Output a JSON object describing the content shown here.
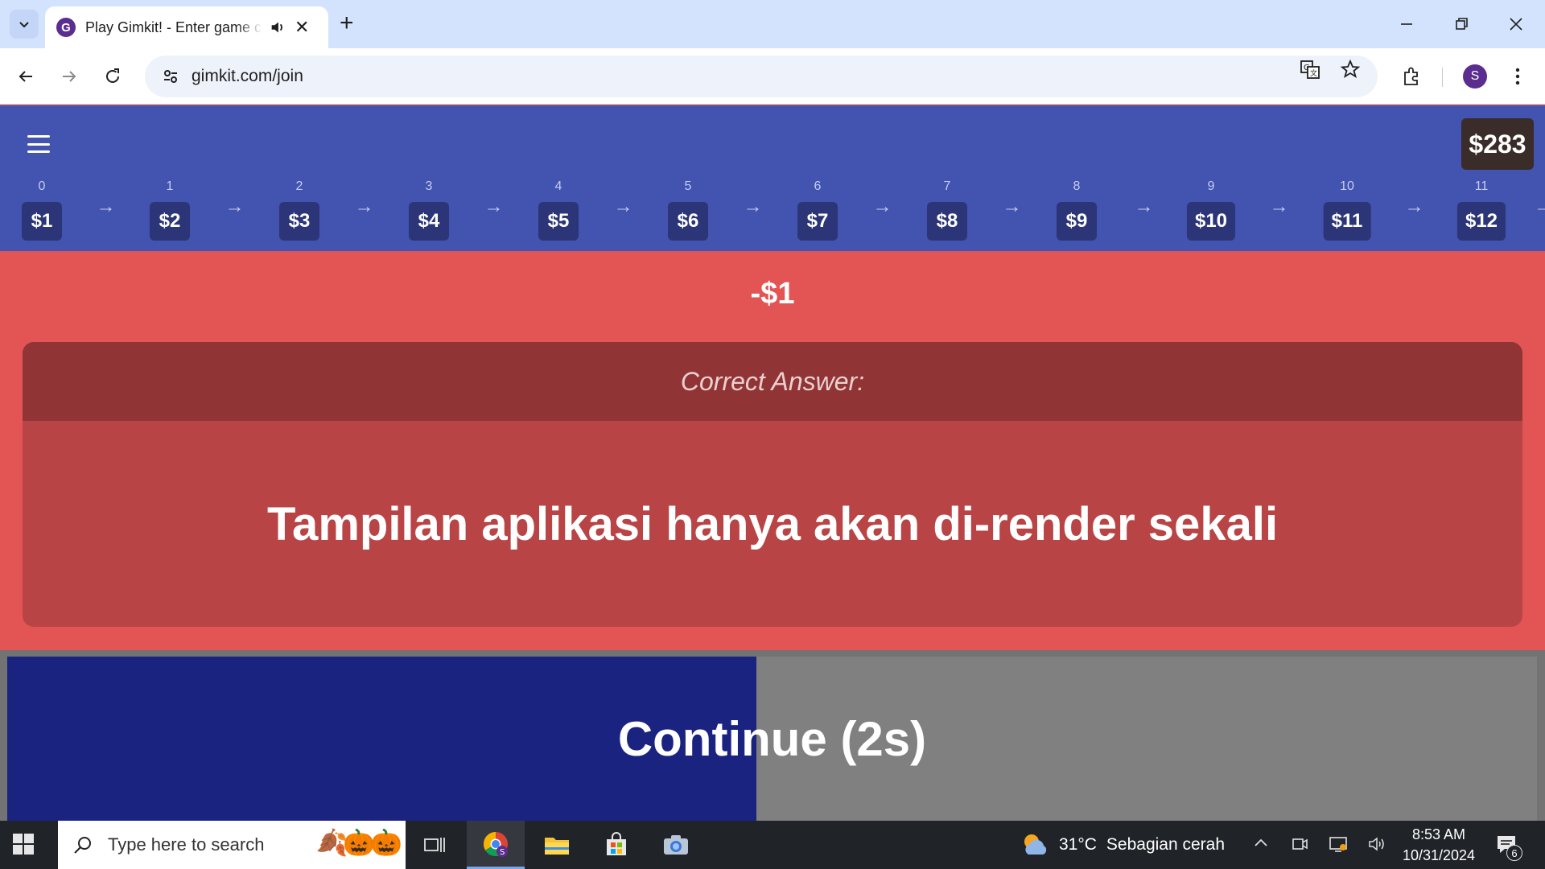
{
  "browser": {
    "tab_title": "Play Gimkit! - Enter game code here",
    "favicon_letter": "G",
    "url": "gimkit.com/join",
    "profile_initial": "S"
  },
  "game": {
    "balance": "$283",
    "ladder": [
      {
        "index": "0",
        "value": "$1"
      },
      {
        "index": "1",
        "value": "$2"
      },
      {
        "index": "2",
        "value": "$3"
      },
      {
        "index": "3",
        "value": "$4"
      },
      {
        "index": "4",
        "value": "$5"
      },
      {
        "index": "5",
        "value": "$6"
      },
      {
        "index": "6",
        "value": "$7"
      },
      {
        "index": "7",
        "value": "$8"
      },
      {
        "index": "8",
        "value": "$9"
      },
      {
        "index": "9",
        "value": "$10"
      },
      {
        "index": "10",
        "value": "$11"
      },
      {
        "index": "11",
        "value": "$12"
      }
    ],
    "delta": "-$1",
    "correct_answer_label": "Correct Answer:",
    "correct_answer_text": "Tampilan aplikasi hanya akan di-render sekali",
    "continue_label": "Continue (2s)",
    "continue_progress": 0.49
  },
  "taskbar": {
    "search_placeholder": "Type here to search",
    "weather_temp": "31°C",
    "weather_desc": "Sebagian cerah",
    "time": "8:53 AM",
    "date": "10/31/2024",
    "notification_count": "6"
  },
  "colors": {
    "header_bg": "#4253b0",
    "feedback_bg": "#e35555",
    "continue_fill": "#1a2380",
    "continue_remaining": "#808080"
  }
}
